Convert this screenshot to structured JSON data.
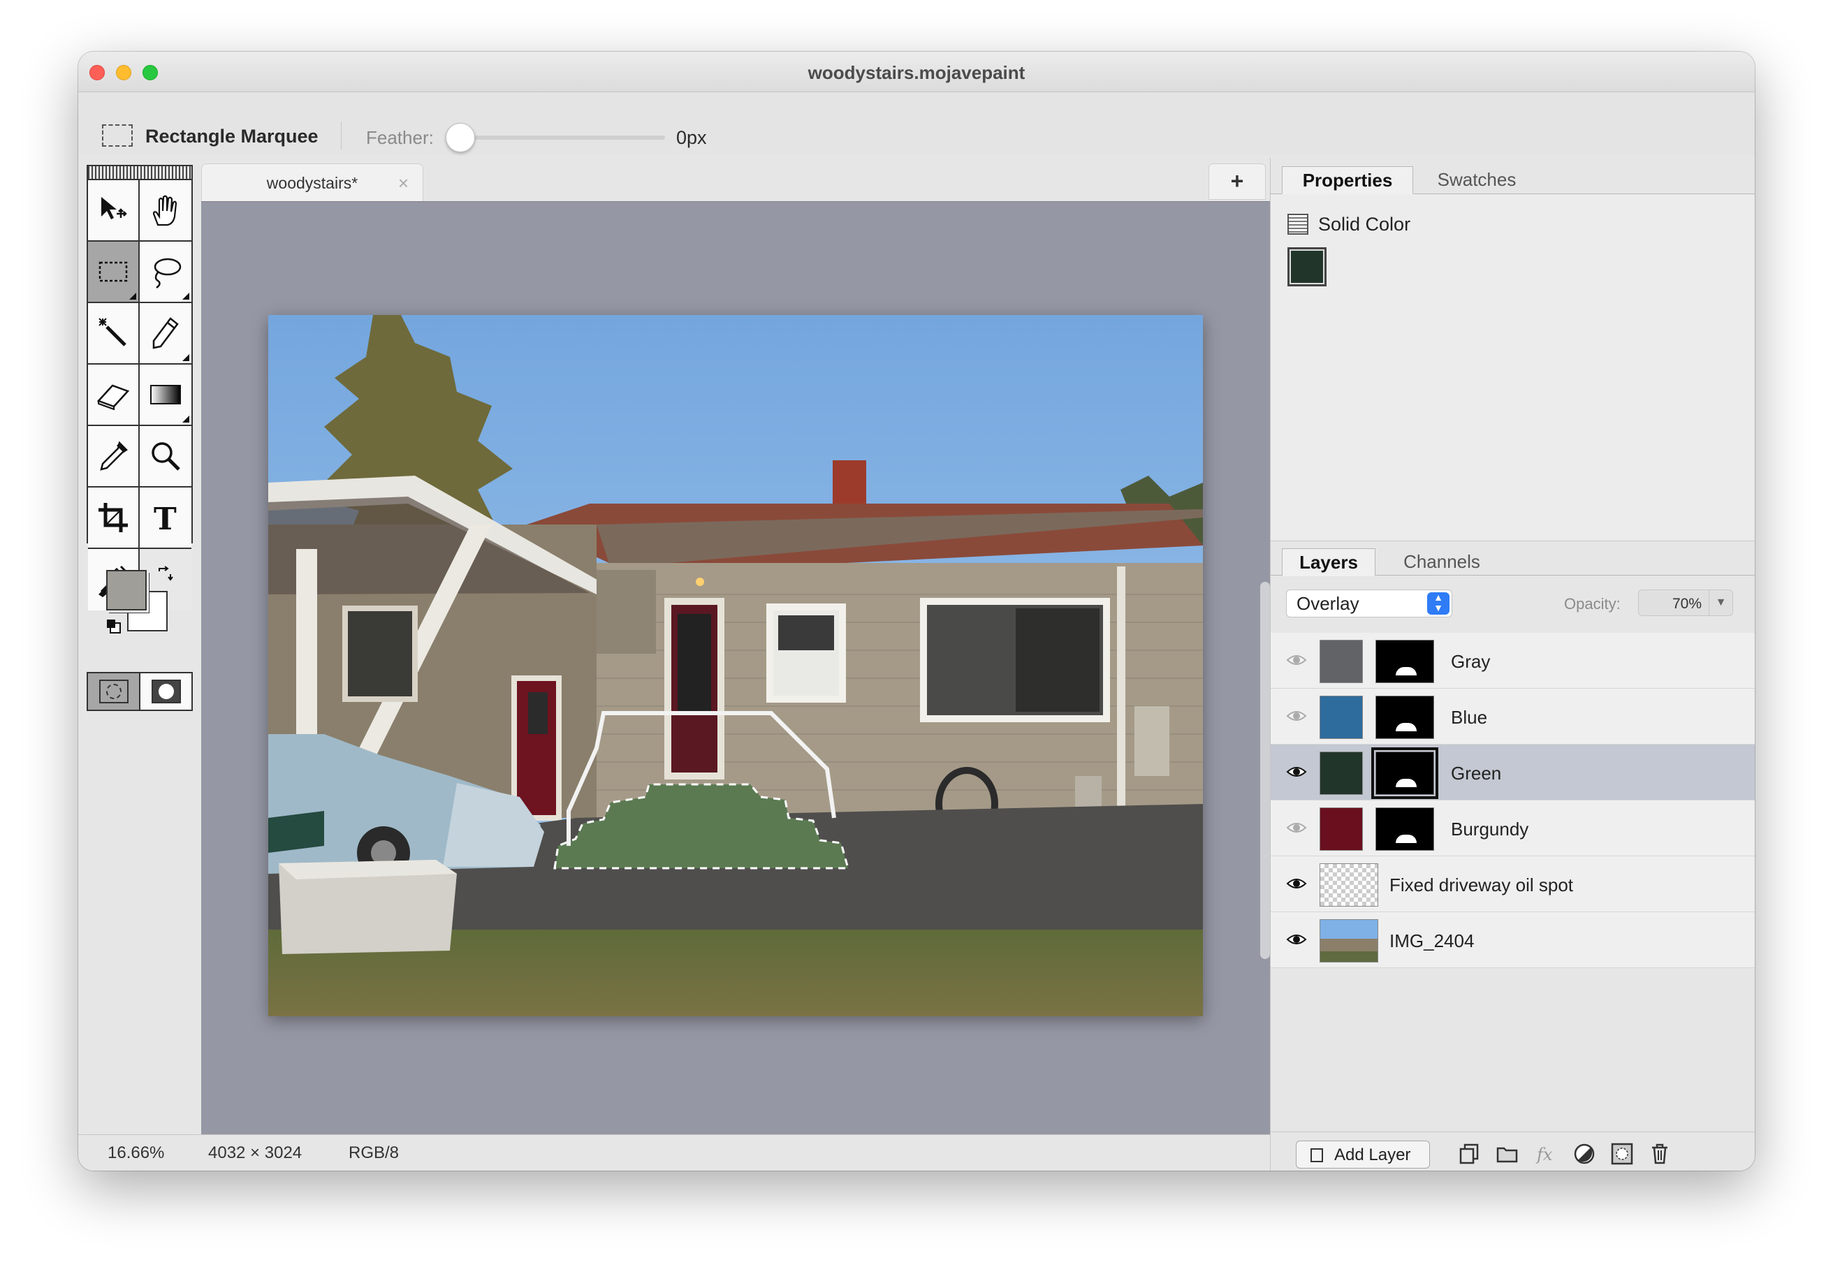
{
  "window": {
    "title": "woodystairs.mojavepaint"
  },
  "options": {
    "tool_name": "Rectangle Marquee",
    "feather_label": "Feather:",
    "feather_value": "0px",
    "feather_level": 0
  },
  "tools": [
    {
      "name": "move-tool",
      "icon": "move-icon"
    },
    {
      "name": "hand-tool",
      "icon": "hand-icon"
    },
    {
      "name": "rectangle-marquee-tool",
      "icon": "rectangle-marquee-icon",
      "selected": true
    },
    {
      "name": "lasso-tool",
      "icon": "lasso-icon"
    },
    {
      "name": "magic-wand-tool",
      "icon": "magic-wand-icon"
    },
    {
      "name": "pencil-tool",
      "icon": "pencil-icon"
    },
    {
      "name": "eraser-tool",
      "icon": "eraser-icon"
    },
    {
      "name": "gradient-tool",
      "icon": "gradient-icon"
    },
    {
      "name": "eyedropper-tool",
      "icon": "eyedropper-icon"
    },
    {
      "name": "zoom-tool",
      "icon": "magnifier-icon"
    },
    {
      "name": "crop-tool",
      "icon": "crop-icon"
    },
    {
      "name": "text-tool",
      "icon": "text-icon"
    },
    {
      "name": "paint-bucket-tool",
      "icon": "paint-bucket-icon"
    }
  ],
  "colors": {
    "foreground": "#a09e98",
    "background": "#ffffff"
  },
  "document": {
    "tab_label": "woodystairs",
    "modified_mark": "*",
    "close_glyph": "×",
    "new_tab_glyph": "+"
  },
  "status": {
    "zoom": "16.66%",
    "dimensions": "4032 × 3024",
    "mode": "RGB/8"
  },
  "panels": {
    "properties_tab": "Properties",
    "swatches_tab": "Swatches",
    "solid_color_label": "Solid Color",
    "solid_color_value": "#22352b",
    "layers_tab": "Layers",
    "channels_tab": "Channels"
  },
  "layers_panel": {
    "blend_mode": "Overlay",
    "opacity_label": "Opacity:",
    "opacity_value": "70%",
    "layers": [
      {
        "name": "Gray",
        "color": "#626366",
        "visible": false,
        "has_mask": true,
        "selected": false
      },
      {
        "name": "Blue",
        "color": "#2e6c9d",
        "visible": false,
        "has_mask": true,
        "selected": false
      },
      {
        "name": "Green",
        "color": "#22352b",
        "visible": true,
        "has_mask": true,
        "selected": true
      },
      {
        "name": "Burgundy",
        "color": "#6a0f1e",
        "visible": false,
        "has_mask": true,
        "selected": false
      },
      {
        "name": "Fixed driveway oil spot",
        "color": "transparent",
        "visible": true,
        "has_mask": false,
        "selected": false
      },
      {
        "name": "IMG_2404",
        "color": "photo",
        "visible": true,
        "has_mask": false,
        "selected": false
      }
    ]
  },
  "bottom_bar": {
    "add_layer_label": "Add Layer"
  }
}
